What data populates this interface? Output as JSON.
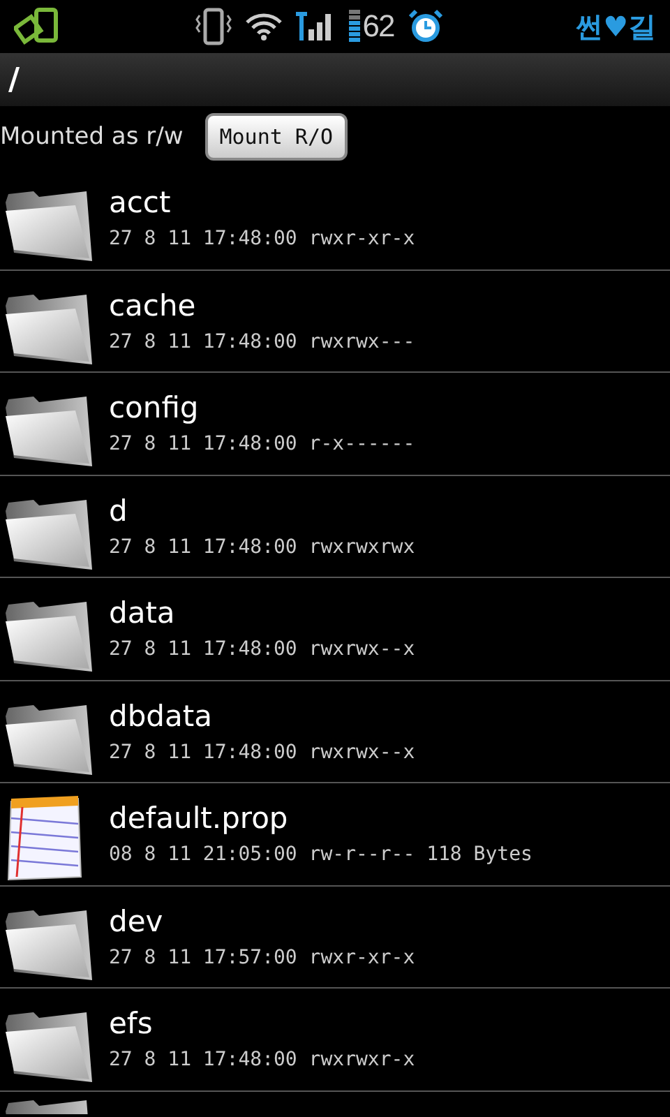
{
  "status_bar": {
    "battery": "62",
    "carrier": "썬♥길"
  },
  "path": "/",
  "mount": {
    "status": "Mounted as r/w",
    "button": "Mount R/O"
  },
  "files": [
    {
      "kind": "folder",
      "name": "acct",
      "details": "27 8 11 17:48:00 rwxr-xr-x"
    },
    {
      "kind": "folder",
      "name": "cache",
      "details": "27 8 11 17:48:00 rwxrwx---"
    },
    {
      "kind": "folder",
      "name": "config",
      "details": "27 8 11 17:48:00 r-x------"
    },
    {
      "kind": "folder",
      "name": "d",
      "details": "27 8 11 17:48:00 rwxrwxrwx"
    },
    {
      "kind": "folder",
      "name": "data",
      "details": "27 8 11 17:48:00 rwxrwx--x"
    },
    {
      "kind": "folder",
      "name": "dbdata",
      "details": "27 8 11 17:48:00 rwxrwx--x"
    },
    {
      "kind": "text",
      "name": "default.prop",
      "details": "08 8 11 21:05:00 rw-r--r-- 118 Bytes"
    },
    {
      "kind": "folder",
      "name": "dev",
      "details": "27 8 11 17:57:00 rwxr-xr-x"
    },
    {
      "kind": "folder",
      "name": "efs",
      "details": "27 8 11 17:48:00 rwxrwxr-x"
    },
    {
      "kind": "folder"
    }
  ]
}
